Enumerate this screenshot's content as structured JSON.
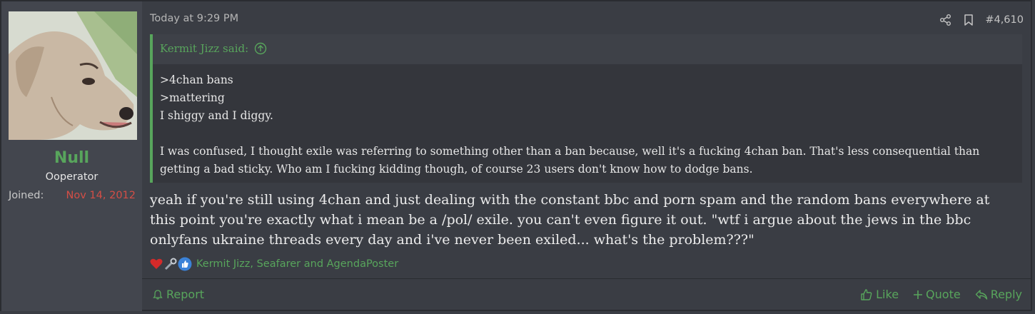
{
  "user": {
    "name": "Null",
    "title": "Ooperator",
    "joined_label": "Joined:",
    "joined_date": "Nov 14, 2012"
  },
  "post": {
    "time": "Today at 9:29 PM",
    "number": "#4,610"
  },
  "quote": {
    "author": "Kermit Jizz said:",
    "lines": [
      ">4chan bans",
      ">mattering",
      "I shiggy and I diggy.",
      "I was confused, I thought exile was referring to something other than a ban because, well it's a fucking 4chan ban. That's less consequential than getting a bad sticky. Who am I fucking kidding though, of course 23 users don't know how to dodge bans."
    ]
  },
  "message": "yeah if you're still using 4chan and just dealing with the constant bbc and porn spam and the random bans everywhere at this point you're exactly what i mean be a /pol/ exile. you can't even figure it out. \"wtf i argue about the jews in the bbc onlyfans ukraine threads every day and i've never been exiled... what's the problem???\"",
  "reactions": {
    "icons": [
      "heart-icon",
      "wrench-icon",
      "thumbs-up-icon"
    ],
    "users": "Kermit Jizz, Seafarer and AgendaPoster"
  },
  "footer": {
    "report": "Report",
    "like": "Like",
    "quote": "Quote",
    "reply": "Reply"
  },
  "colors": {
    "accent": "#58a55c",
    "joined_date": "#d44e46",
    "background": "#3a3d44"
  }
}
